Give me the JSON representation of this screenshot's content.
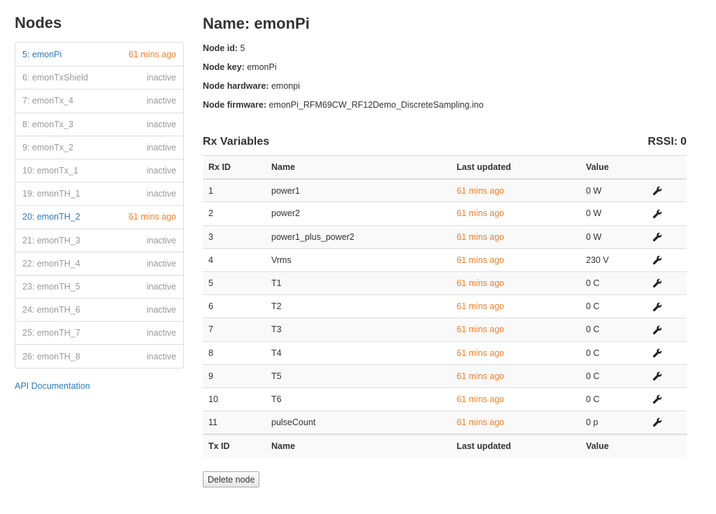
{
  "sidebar": {
    "title": "Nodes",
    "nodes": [
      {
        "label": "5: emonPi",
        "status": "61 mins ago",
        "active": true
      },
      {
        "label": "6: emonTxShield",
        "status": "inactive",
        "active": false
      },
      {
        "label": "7: emonTx_4",
        "status": "inactive",
        "active": false
      },
      {
        "label": "8: emonTx_3",
        "status": "inactive",
        "active": false
      },
      {
        "label": "9: emonTx_2",
        "status": "inactive",
        "active": false
      },
      {
        "label": "10: emonTx_1",
        "status": "inactive",
        "active": false
      },
      {
        "label": "19: emonTH_1",
        "status": "inactive",
        "active": false
      },
      {
        "label": "20: emonTH_2",
        "status": "61 mins ago",
        "active": true
      },
      {
        "label": "21: emonTH_3",
        "status": "inactive",
        "active": false
      },
      {
        "label": "22: emonTH_4",
        "status": "inactive",
        "active": false
      },
      {
        "label": "23: emonTH_5",
        "status": "inactive",
        "active": false
      },
      {
        "label": "24: emonTH_6",
        "status": "inactive",
        "active": false
      },
      {
        "label": "25: emonTH_7",
        "status": "inactive",
        "active": false
      },
      {
        "label": "26: emonTH_8",
        "status": "inactive",
        "active": false
      }
    ],
    "api_link": "API Documentation"
  },
  "node": {
    "title": "Name: emonPi",
    "id_label": "Node id:",
    "id_value": "5",
    "key_label": "Node key:",
    "key_value": "emonPi",
    "hardware_label": "Node hardware:",
    "hardware_value": "emonpi",
    "firmware_label": "Node firmware:",
    "firmware_value": "emonPi_RFM69CW_RF12Demo_DiscreteSampling.ino"
  },
  "rx": {
    "heading": "Rx Variables",
    "rssi_label": "RSSI:",
    "rssi_value": "0",
    "headers": {
      "id": "Rx ID",
      "name": "Name",
      "updated": "Last updated",
      "value": "Value"
    },
    "rows": [
      {
        "id": "1",
        "name": "power1",
        "updated": "61 mins ago",
        "value": "0 W"
      },
      {
        "id": "2",
        "name": "power2",
        "updated": "61 mins ago",
        "value": "0 W"
      },
      {
        "id": "3",
        "name": "power1_plus_power2",
        "updated": "61 mins ago",
        "value": "0 W"
      },
      {
        "id": "4",
        "name": "Vrms",
        "updated": "61 mins ago",
        "value": "230 V"
      },
      {
        "id": "5",
        "name": "T1",
        "updated": "61 mins ago",
        "value": "0 C"
      },
      {
        "id": "6",
        "name": "T2",
        "updated": "61 mins ago",
        "value": "0 C"
      },
      {
        "id": "7",
        "name": "T3",
        "updated": "61 mins ago",
        "value": "0 C"
      },
      {
        "id": "8",
        "name": "T4",
        "updated": "61 mins ago",
        "value": "0 C"
      },
      {
        "id": "9",
        "name": "T5",
        "updated": "61 mins ago",
        "value": "0 C"
      },
      {
        "id": "10",
        "name": "T6",
        "updated": "61 mins ago",
        "value": "0 C"
      },
      {
        "id": "11",
        "name": "pulseCount",
        "updated": "61 mins ago",
        "value": "0 p"
      }
    ],
    "row_icon": "wrench-icon"
  },
  "tx": {
    "headers": {
      "id": "Tx ID",
      "name": "Name",
      "updated": "Last updated",
      "value": "Value"
    }
  },
  "actions": {
    "delete_label": "Delete node"
  },
  "colors": {
    "link": "#2a7ab8",
    "recent": "#f0812a",
    "inactive": "#999999"
  }
}
